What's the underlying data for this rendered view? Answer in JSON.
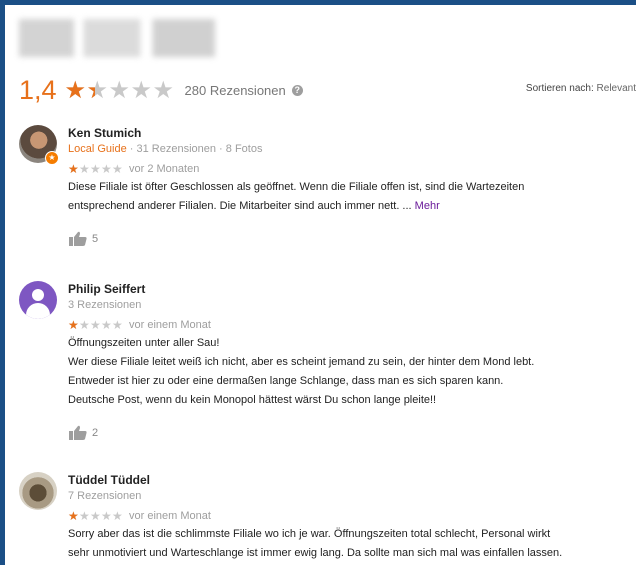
{
  "summary": {
    "rating": "1,4",
    "rating_value": 1.4,
    "max_stars": 5,
    "review_count": "280 Rezensionen",
    "sort_label": "Sortieren nach:",
    "sort_value": "Relevant"
  },
  "reviews": [
    {
      "name": "Ken Stumich",
      "local_guide": "Local Guide",
      "meta": " · 31 Rezensionen · 8 Fotos",
      "stars": 1,
      "time": "vor 2 Monaten",
      "lines": [
        "Diese Filiale ist öfter Geschlossen als geöffnet. Wenn die Filiale offen ist, sind die Wartezeiten",
        "entsprechend anderer Filialen. Die Mitarbeiter sind auch immer nett. ..."
      ],
      "more": "Mehr",
      "likes": "5"
    },
    {
      "name": "Philip Seiffert",
      "meta": "3 Rezensionen",
      "stars": 1,
      "time": "vor einem Monat",
      "lines": [
        "Öffnungszeiten unter aller Sau!",
        "Wer diese Filiale leitet weiß ich nicht, aber es scheint jemand zu sein, der hinter dem Mond lebt.",
        "Entweder ist hier zu oder eine dermaßen lange Schlange, dass man es sich sparen kann.",
        "Deutsche Post, wenn du kein Monopol hättest wärst Du schon lange pleite!!"
      ],
      "likes": "2"
    },
    {
      "name": "Tüddel Tüddel",
      "meta": "7 Rezensionen",
      "stars": 1,
      "time": "vor einem Monat",
      "lines": [
        "Sorry aber das ist die schlimmste Filiale wo ich je war. Öffnungszeiten total schlecht, Personal wirkt",
        "sehr unmotiviert und Warteschlange ist immer ewig lang. Da sollte man sich mal was einfallen lassen."
      ]
    }
  ],
  "colors": {
    "accent": "#e7711b",
    "link": "#6a1b9a",
    "frame": "#1b4f86"
  }
}
